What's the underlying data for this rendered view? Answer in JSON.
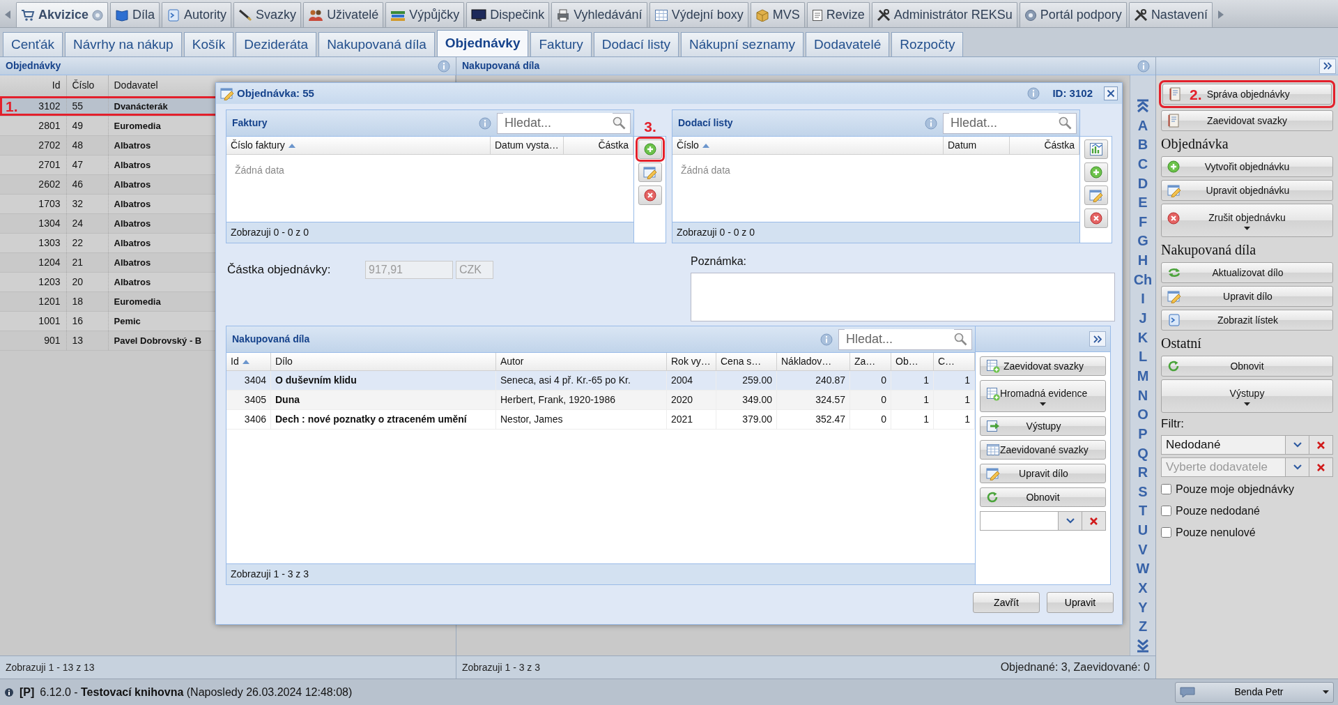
{
  "top_nav": {
    "tabs": [
      {
        "label": "Akvizice",
        "help": true,
        "selected": true
      },
      {
        "label": "Díla",
        "help": false,
        "selected": false
      },
      {
        "label": "Autority",
        "help": false,
        "selected": false
      },
      {
        "label": "Svazky",
        "help": false,
        "selected": false
      },
      {
        "label": "Uživatelé",
        "help": false,
        "selected": false
      },
      {
        "label": "Výpůjčky",
        "help": false,
        "selected": false
      },
      {
        "label": "Dispečink",
        "help": false,
        "selected": false
      },
      {
        "label": "Vyhledávání",
        "help": false,
        "selected": false
      },
      {
        "label": "Výdejní boxy",
        "help": false,
        "selected": false
      },
      {
        "label": "MVS",
        "help": false,
        "selected": false
      },
      {
        "label": "Revize",
        "help": false,
        "selected": false
      },
      {
        "label": "Administrátor REKSu",
        "help": false,
        "selected": false
      },
      {
        "label": "Portál podpory",
        "help": false,
        "selected": false
      },
      {
        "label": "Nastavení",
        "help": false,
        "selected": false
      }
    ]
  },
  "sub_tabs": [
    {
      "label": "Cenťák",
      "selected": false
    },
    {
      "label": "Návrhy na nákup",
      "selected": false
    },
    {
      "label": "Košík",
      "selected": false
    },
    {
      "label": "Dezideráta",
      "selected": false
    },
    {
      "label": "Nakupovaná díla",
      "selected": false
    },
    {
      "label": "Objednávky",
      "selected": true
    },
    {
      "label": "Faktury",
      "selected": false
    },
    {
      "label": "Dodací listy",
      "selected": false
    },
    {
      "label": "Nákupní seznamy",
      "selected": false
    },
    {
      "label": "Dodavatelé",
      "selected": false
    },
    {
      "label": "Rozpočty",
      "selected": false
    }
  ],
  "orders_panel": {
    "title": "Objednávky",
    "columns": [
      "Id",
      "Číslo",
      "Dodavatel"
    ],
    "rows": [
      {
        "id": "3102",
        "number": "55",
        "supplier": "Dvanácterák",
        "selected": true,
        "annotation": "1."
      },
      {
        "id": "2801",
        "number": "49",
        "supplier": "Euromedia",
        "selected": false
      },
      {
        "id": "2702",
        "number": "48",
        "supplier": "Albatros",
        "selected": false
      },
      {
        "id": "2701",
        "number": "47",
        "supplier": "Albatros",
        "selected": false
      },
      {
        "id": "2602",
        "number": "46",
        "supplier": "Albatros",
        "selected": false
      },
      {
        "id": "1703",
        "number": "32",
        "supplier": "Albatros",
        "selected": false
      },
      {
        "id": "1304",
        "number": "24",
        "supplier": "Albatros",
        "selected": false
      },
      {
        "id": "1303",
        "number": "22",
        "supplier": "Albatros",
        "selected": false
      },
      {
        "id": "1204",
        "number": "21",
        "supplier": "Albatros",
        "selected": false
      },
      {
        "id": "1203",
        "number": "20",
        "supplier": "Albatros",
        "selected": false
      },
      {
        "id": "1201",
        "number": "18",
        "supplier": "Euromedia",
        "selected": false
      },
      {
        "id": "1001",
        "number": "16",
        "supplier": "Pemic",
        "selected": false
      },
      {
        "id": "901",
        "number": "13",
        "supplier": "Pavel Dobrovský - B",
        "selected": false
      }
    ],
    "footer": "Zobrazuji 1 - 13 z 13"
  },
  "works_panel": {
    "title": "Nakupovaná díla",
    "alphabet": [
      "A",
      "B",
      "C",
      "D",
      "E",
      "F",
      "G",
      "H",
      "Ch",
      "I",
      "J",
      "K",
      "L",
      "M",
      "N",
      "O",
      "P",
      "Q",
      "R",
      "S",
      "T",
      "U",
      "V",
      "W",
      "X",
      "Y",
      "Z"
    ],
    "footer": "Zobrazuji 1 - 3 z 3",
    "summary": "Objednané: 3, Zaevidované: 0"
  },
  "sidebar": {
    "items": [
      {
        "kind": "button",
        "label": "Správa objednávky",
        "annotation": "2.",
        "dropdown": false
      },
      {
        "kind": "button",
        "label": "Zaevidovat svazky",
        "dropdown": false
      },
      {
        "kind": "heading",
        "label": "Objednávka"
      },
      {
        "kind": "button",
        "label": "Vytvořit objednávku",
        "dropdown": false
      },
      {
        "kind": "button",
        "label": "Upravit objednávku",
        "dropdown": false
      },
      {
        "kind": "button",
        "label": "Zrušit objednávku",
        "dropdown": true
      },
      {
        "kind": "heading",
        "label": "Nakupovaná díla"
      },
      {
        "kind": "button",
        "label": "Aktualizovat dílo",
        "dropdown": false
      },
      {
        "kind": "button",
        "label": "Upravit dílo",
        "dropdown": false
      },
      {
        "kind": "button",
        "label": "Zobrazit lístek",
        "dropdown": false
      },
      {
        "kind": "heading",
        "label": "Ostatní"
      },
      {
        "kind": "button",
        "label": "Obnovit",
        "dropdown": false
      },
      {
        "kind": "button",
        "label": "Výstupy",
        "dropdown": true
      },
      {
        "kind": "label",
        "label": "Filtr:"
      },
      {
        "kind": "select",
        "value": "Nedodané"
      },
      {
        "kind": "select",
        "placeholder": "Vyberte dodavatele"
      },
      {
        "kind": "checkbox",
        "label": "Pouze moje objednávky",
        "checked": false
      },
      {
        "kind": "checkbox",
        "label": "Pouze nedodané",
        "checked": false
      },
      {
        "kind": "checkbox",
        "label": "Pouze nenulové",
        "checked": false
      }
    ]
  },
  "dialog": {
    "title": "Objednávka: 55",
    "id_label": "ID: 3102",
    "invoices": {
      "title": "Faktury",
      "search": {
        "placeholder": "Hledat..."
      },
      "columns": [
        {
          "label": "Číslo faktury",
          "sorted": true
        },
        {
          "label": "Datum vysta…",
          "sorted": false
        },
        {
          "label": "Částka",
          "sorted": false
        }
      ],
      "empty_text": "Žádná data",
      "footer": "Zobrazuji 0 - 0 z 0",
      "annotation": "3."
    },
    "delivery_notes": {
      "title": "Dodací listy",
      "search": {
        "placeholder": "Hledat..."
      },
      "columns": [
        {
          "label": "Číslo",
          "sorted": true
        },
        {
          "label": "Datum",
          "sorted": false
        },
        {
          "label": "Částka",
          "sorted": false
        }
      ],
      "empty_text": "Žádná data",
      "footer": "Zobrazuji 0 - 0 z 0"
    },
    "amount": {
      "label": "Částka objednávky:",
      "value": "917,91",
      "currency": "CZK",
      "disabled": true
    },
    "note": {
      "label": "Poznámka:"
    },
    "works": {
      "title": "Nakupovaná díla",
      "search": {
        "placeholder": "Hledat..."
      },
      "columns": [
        {
          "label": "Id",
          "sorted": true
        },
        {
          "label": "Dílo",
          "sorted": false
        },
        {
          "label": "Autor",
          "sorted": false
        },
        {
          "label": "Rok vy…",
          "sorted": false
        },
        {
          "label": "Cena s…",
          "sorted": false
        },
        {
          "label": "Nákladov…",
          "sorted": false
        },
        {
          "label": "Za…",
          "sorted": false
        },
        {
          "label": "Ob…",
          "sorted": false
        },
        {
          "label": "C…",
          "sorted": false
        }
      ],
      "rows": [
        {
          "cells": [
            "3404",
            "O duševním klidu",
            "Seneca, asi 4 př. Kr.-65 po Kr.",
            "2004",
            "259.00",
            "240.87",
            "0",
            "1",
            "1"
          ],
          "selected": true
        },
        {
          "cells": [
            "3405",
            "Duna",
            "Herbert, Frank, 1920-1986",
            "2020",
            "349.00",
            "324.57",
            "0",
            "1",
            "1"
          ],
          "selected": false
        },
        {
          "cells": [
            "3406",
            "Dech : nové poznatky o ztraceném umění",
            "Nestor, James",
            "2021",
            "379.00",
            "352.47",
            "0",
            "1",
            "1"
          ],
          "selected": false
        }
      ],
      "footer": "Zobrazuji 1 - 3 z 3",
      "actions": [
        {
          "label": "Zaevidovat svazky",
          "dropdown": false
        },
        {
          "label": "Hromadná evidence",
          "dropdown": true
        },
        {
          "label": "Výstupy",
          "dropdown": false
        },
        {
          "label": "Zaevidované svazky",
          "dropdown": false
        },
        {
          "label": "Upravit dílo",
          "dropdown": false
        },
        {
          "label": "Obnovit",
          "dropdown": false
        }
      ]
    },
    "buttons": [
      "Zavřít",
      "Upravit"
    ]
  },
  "status_bar": {
    "mode": "[P]",
    "text": "6.12.0 - **Testovací knihovna** (Naposledy 26.03.2024 12:48:08)",
    "user": "Benda Petr"
  }
}
